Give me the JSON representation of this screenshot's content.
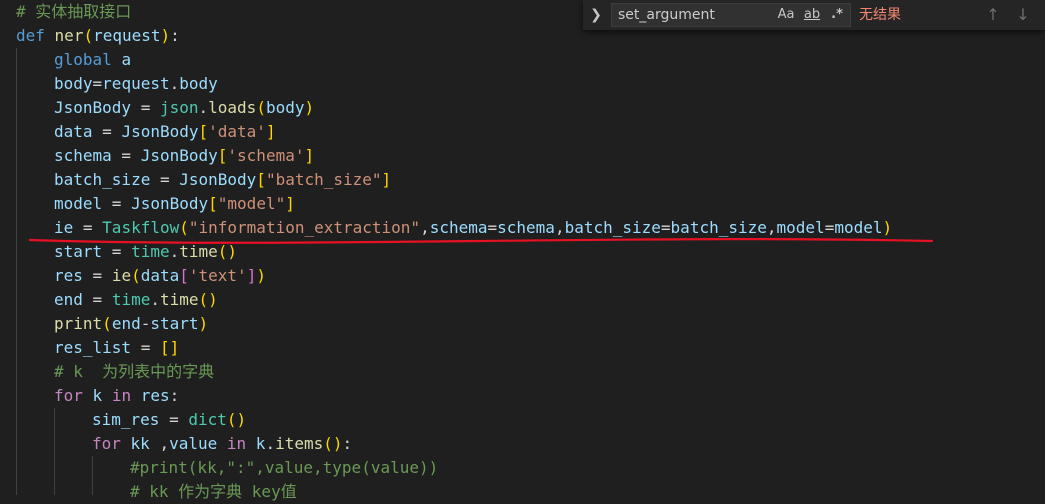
{
  "editor": {
    "lines": [
      {
        "indent": 0,
        "tokens": [
          {
            "t": "# 实体抽取接口",
            "c": "cm"
          }
        ]
      },
      {
        "indent": 0,
        "tokens": [
          {
            "t": "def",
            "c": "kw"
          },
          {
            "t": " "
          },
          {
            "t": "ner",
            "c": "fn"
          },
          {
            "t": "(",
            "c": "br1"
          },
          {
            "t": "request",
            "c": "var"
          },
          {
            "t": ")",
            "c": "br1"
          },
          {
            "t": ":"
          }
        ]
      },
      {
        "indent": 1,
        "tokens": [
          {
            "t": "global",
            "c": "kw"
          },
          {
            "t": " "
          },
          {
            "t": "a",
            "c": "var"
          }
        ]
      },
      {
        "indent": 1,
        "tokens": [
          {
            "t": "body",
            "c": "var"
          },
          {
            "t": "="
          },
          {
            "t": "request",
            "c": "var"
          },
          {
            "t": "."
          },
          {
            "t": "body",
            "c": "var"
          }
        ]
      },
      {
        "indent": 1,
        "tokens": [
          {
            "t": "JsonBody",
            "c": "var"
          },
          {
            "t": " = "
          },
          {
            "t": "json",
            "c": "cls"
          },
          {
            "t": "."
          },
          {
            "t": "loads",
            "c": "fn"
          },
          {
            "t": "(",
            "c": "br1"
          },
          {
            "t": "body",
            "c": "var"
          },
          {
            "t": ")",
            "c": "br1"
          }
        ]
      },
      {
        "indent": 1,
        "tokens": [
          {
            "t": "data",
            "c": "var"
          },
          {
            "t": " = "
          },
          {
            "t": "JsonBody",
            "c": "var"
          },
          {
            "t": "[",
            "c": "br1"
          },
          {
            "t": "'data'",
            "c": "str"
          },
          {
            "t": "]",
            "c": "br1"
          }
        ]
      },
      {
        "indent": 1,
        "tokens": [
          {
            "t": "schema",
            "c": "var"
          },
          {
            "t": " = "
          },
          {
            "t": "JsonBody",
            "c": "var"
          },
          {
            "t": "[",
            "c": "br1"
          },
          {
            "t": "'schema'",
            "c": "str"
          },
          {
            "t": "]",
            "c": "br1"
          }
        ]
      },
      {
        "indent": 1,
        "tokens": [
          {
            "t": "batch_size",
            "c": "var"
          },
          {
            "t": " = "
          },
          {
            "t": "JsonBody",
            "c": "var"
          },
          {
            "t": "[",
            "c": "br1"
          },
          {
            "t": "\"batch_size\"",
            "c": "str"
          },
          {
            "t": "]",
            "c": "br1"
          }
        ]
      },
      {
        "indent": 1,
        "tokens": [
          {
            "t": "model",
            "c": "var"
          },
          {
            "t": " = "
          },
          {
            "t": "JsonBody",
            "c": "var"
          },
          {
            "t": "[",
            "c": "br1"
          },
          {
            "t": "\"model\"",
            "c": "str"
          },
          {
            "t": "]",
            "c": "br1"
          }
        ]
      },
      {
        "indent": 1,
        "tokens": [
          {
            "t": "ie",
            "c": "var"
          },
          {
            "t": " = "
          },
          {
            "t": "Taskflow",
            "c": "cls"
          },
          {
            "t": "(",
            "c": "br1"
          },
          {
            "t": "\"information_extraction\"",
            "c": "str"
          },
          {
            "t": ","
          },
          {
            "t": "schema",
            "c": "var"
          },
          {
            "t": "="
          },
          {
            "t": "schema",
            "c": "var"
          },
          {
            "t": ","
          },
          {
            "t": "batch_size",
            "c": "var"
          },
          {
            "t": "="
          },
          {
            "t": "batch_size",
            "c": "var"
          },
          {
            "t": ","
          },
          {
            "t": "model",
            "c": "var"
          },
          {
            "t": "="
          },
          {
            "t": "model",
            "c": "var"
          },
          {
            "t": ")",
            "c": "br1"
          }
        ]
      },
      {
        "indent": 1,
        "tokens": [
          {
            "t": "start",
            "c": "var"
          },
          {
            "t": " = "
          },
          {
            "t": "time",
            "c": "cls"
          },
          {
            "t": "."
          },
          {
            "t": "time",
            "c": "fn"
          },
          {
            "t": "()",
            "c": "br1"
          }
        ]
      },
      {
        "indent": 1,
        "tokens": [
          {
            "t": "res",
            "c": "var"
          },
          {
            "t": " = "
          },
          {
            "t": "ie",
            "c": "fn"
          },
          {
            "t": "(",
            "c": "br1"
          },
          {
            "t": "data",
            "c": "var"
          },
          {
            "t": "[",
            "c": "br2"
          },
          {
            "t": "'text'",
            "c": "str"
          },
          {
            "t": "]",
            "c": "br2"
          },
          {
            "t": ")",
            "c": "br1"
          }
        ]
      },
      {
        "indent": 1,
        "tokens": [
          {
            "t": "end",
            "c": "var"
          },
          {
            "t": " = "
          },
          {
            "t": "time",
            "c": "cls"
          },
          {
            "t": "."
          },
          {
            "t": "time",
            "c": "fn"
          },
          {
            "t": "()",
            "c": "br1"
          }
        ]
      },
      {
        "indent": 1,
        "tokens": [
          {
            "t": "print",
            "c": "fn"
          },
          {
            "t": "(",
            "c": "br1"
          },
          {
            "t": "end",
            "c": "var"
          },
          {
            "t": "-"
          },
          {
            "t": "start",
            "c": "var"
          },
          {
            "t": ")",
            "c": "br1"
          }
        ]
      },
      {
        "indent": 1,
        "tokens": [
          {
            "t": "res_list",
            "c": "var"
          },
          {
            "t": " = "
          },
          {
            "t": "[]",
            "c": "br1"
          }
        ]
      },
      {
        "indent": 1,
        "tokens": [
          {
            "t": "# k  为列表中的字典",
            "c": "cm"
          }
        ]
      },
      {
        "indent": 1,
        "tokens": [
          {
            "t": "for",
            "c": "ctl"
          },
          {
            "t": " "
          },
          {
            "t": "k",
            "c": "var"
          },
          {
            "t": " "
          },
          {
            "t": "in",
            "c": "ctl"
          },
          {
            "t": " "
          },
          {
            "t": "res",
            "c": "var"
          },
          {
            "t": ":"
          }
        ]
      },
      {
        "indent": 2,
        "tokens": [
          {
            "t": "sim_res",
            "c": "var"
          },
          {
            "t": " = "
          },
          {
            "t": "dict",
            "c": "cls"
          },
          {
            "t": "()",
            "c": "br1"
          }
        ]
      },
      {
        "indent": 2,
        "tokens": [
          {
            "t": "for",
            "c": "ctl"
          },
          {
            "t": " "
          },
          {
            "t": "kk",
            "c": "var"
          },
          {
            "t": " ,"
          },
          {
            "t": "value",
            "c": "var"
          },
          {
            "t": " "
          },
          {
            "t": "in",
            "c": "ctl"
          },
          {
            "t": " "
          },
          {
            "t": "k",
            "c": "var"
          },
          {
            "t": "."
          },
          {
            "t": "items",
            "c": "fn"
          },
          {
            "t": "()",
            "c": "br1"
          },
          {
            "t": ":"
          }
        ]
      },
      {
        "indent": 3,
        "tokens": [
          {
            "t": "#print(kk,\":\",value,type(value))",
            "c": "cm"
          }
        ]
      },
      {
        "indent": 3,
        "tokens": [
          {
            "t": "# kk 作为字典 key值",
            "c": "cm"
          }
        ]
      }
    ]
  },
  "find_widget": {
    "toggle_icon": "chevron-right-icon",
    "query": "set_argument",
    "match_case_label": "Aa",
    "whole_word_label": "ab",
    "regex_label": ".*",
    "status": "无结果",
    "prev_icon": "arrow-up-icon",
    "next_icon": "arrow-down-icon"
  },
  "annotation": {
    "color": "#e81123"
  }
}
